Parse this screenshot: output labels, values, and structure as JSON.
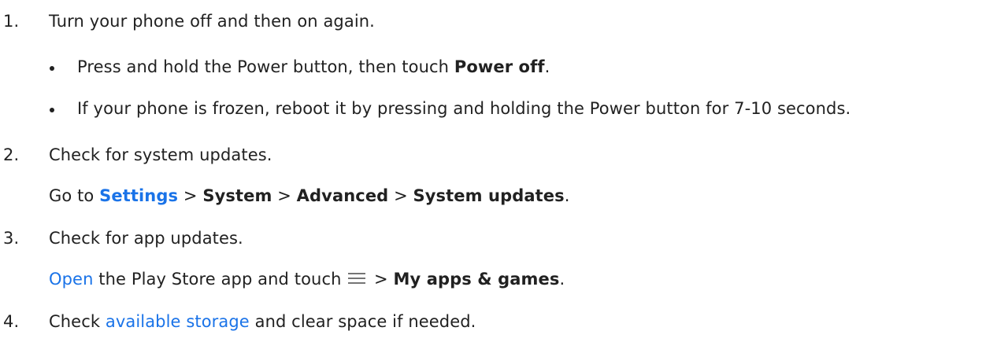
{
  "steps": [
    {
      "number": "1.",
      "text": "Turn your phone off and then on again.",
      "bullets": [
        {
          "pre": "Press and hold the Power button, then touch ",
          "bold": "Power off",
          "post": "."
        },
        {
          "text": "If your phone is frozen, reboot it by pressing and holding the Power button for 7-10 seconds."
        }
      ]
    },
    {
      "number": "2.",
      "text": "Check for system updates.",
      "detail": {
        "go_to": "Go to ",
        "settings_link": "Settings",
        "sep": " > ",
        "system": "System",
        "advanced": "Advanced",
        "system_updates": "System updates",
        "end": "."
      }
    },
    {
      "number": "3.",
      "text": "Check for app updates.",
      "detail": {
        "open_link": "Open",
        "middle": " the Play Store app and touch ",
        "menu_icon": "menu-icon",
        "sep": " > ",
        "my_apps": "My apps & games",
        "end": "."
      }
    },
    {
      "number": "4.",
      "pre": "Check ",
      "storage_link": "available storage",
      "post": " and clear space if needed."
    }
  ],
  "colors": {
    "text": "#212121",
    "link": "#1a73e8",
    "icon": "#757575"
  }
}
